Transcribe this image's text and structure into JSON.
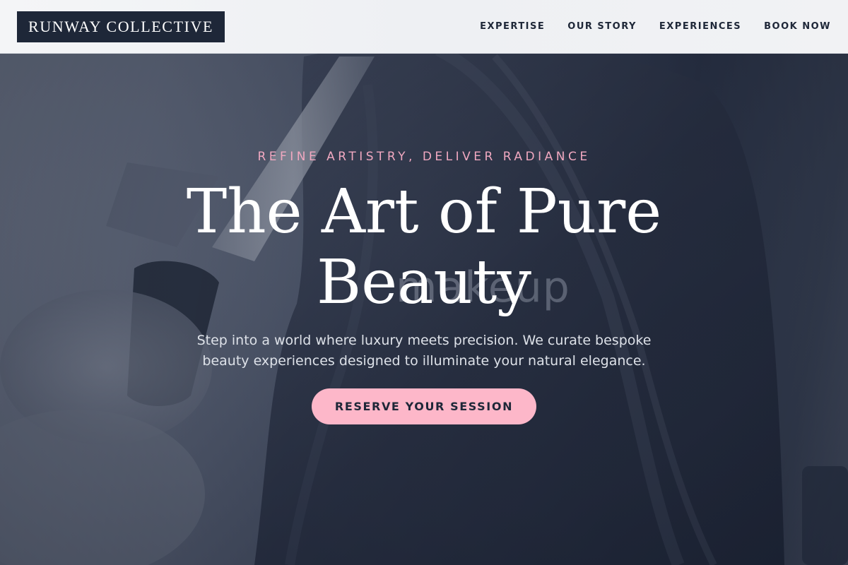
{
  "header": {
    "brand": "RUNWAY COLLECTIVE",
    "nav": [
      {
        "label": "EXPERTISE"
      },
      {
        "label": "OUR STORY"
      },
      {
        "label": "EXPERIENCES"
      },
      {
        "label": "BOOK NOW"
      }
    ]
  },
  "hero": {
    "eyebrow": "REFINE ARTISTRY, DELIVER RADIANCE",
    "headline_line1": "The Art of Pure",
    "headline_line2": "Beauty",
    "background_text": "makeup",
    "subtext": "Step into a world where luxury meets precision. We curate bespoke beauty experiences designed to illuminate your natural elegance.",
    "cta_label": "RESERVE YOUR SESSION"
  },
  "colors": {
    "brand_dark": "#1e2738",
    "accent_pink": "#fdb7c9",
    "eyebrow_pink": "#f0a8c0",
    "header_bg": "#f2f3f5"
  }
}
